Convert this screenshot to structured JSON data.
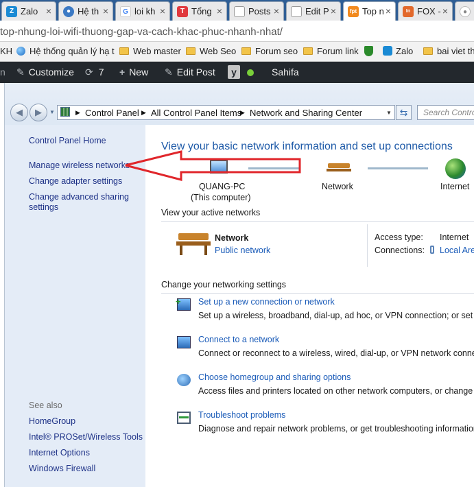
{
  "browser": {
    "tabs": [
      {
        "label": "Zalo",
        "icon": "zalo-icon",
        "color": "#1a8ad4"
      },
      {
        "label": "Hệ th",
        "icon": "globe-icon",
        "color": "#3b79c4"
      },
      {
        "label": "loi kh",
        "icon": "google-icon",
        "color": "#4285f4"
      },
      {
        "label": "Tổng",
        "icon": "t-logo-icon",
        "color": "#e0393e"
      },
      {
        "label": "Posts",
        "icon": "page-icon",
        "color": "#9a9a9a"
      },
      {
        "label": "Edit P",
        "icon": "page-icon",
        "color": "#9a9a9a"
      },
      {
        "label": "Top n",
        "icon": "fpt-icon",
        "color": "#f28a1e"
      },
      {
        "label": "FOX -",
        "icon": "inside-icon",
        "color": "#e2682b"
      },
      {
        "label": "",
        "icon": "globe-icon",
        "color": "#9a9a9a"
      }
    ],
    "tab_close": "×",
    "url": "top-nhung-loi-wifi-thuong-gap-va-cach-khac-phuc-nhanh-nhat/",
    "bookmarks": [
      {
        "label": "KH"
      },
      {
        "label": "Hệ thống quản lý hạ t",
        "icon": "globe-icon"
      },
      {
        "label": "Web master",
        "icon": "folder-icon"
      },
      {
        "label": "Web Seo",
        "icon": "folder-icon"
      },
      {
        "label": "Forum seo",
        "icon": "folder-icon"
      },
      {
        "label": "Forum link",
        "icon": "folder-icon"
      },
      {
        "label": "",
        "icon": "shield-icon"
      },
      {
        "label": "Zalo",
        "icon": "zalo-icon"
      },
      {
        "label": "bai viet thu",
        "icon": "folder-icon"
      }
    ]
  },
  "wp_bar": {
    "customize": "Customize",
    "updates": "7",
    "new": "New",
    "edit_post": "Edit Post",
    "sahifa": "Sahifa"
  },
  "explorer": {
    "breadcrumb": [
      "Control Panel",
      "All Control Panel Items",
      "Network and Sharing Center"
    ],
    "search_placeholder": "Search Control",
    "sidebar": {
      "home": "Control Panel Home",
      "links": [
        "Manage wireless networks",
        "Change adapter settings",
        "Change advanced sharing settings"
      ],
      "see_also_title": "See also",
      "see_also": [
        "HomeGroup",
        "Intel® PROSet/Wireless Tools",
        "Internet Options",
        "Windows Firewall"
      ]
    },
    "main": {
      "title": "View your basic network information and set up connections",
      "map": {
        "computer_name": "QUANG-PC",
        "computer_sub": "(This computer)",
        "network": "Network",
        "internet": "Internet"
      },
      "active_title": "View your active networks",
      "active": {
        "name": "Network",
        "type": "Public network",
        "access_label": "Access type:",
        "access_value": "Internet",
        "connections_label": "Connections:",
        "connections_value": "Local Are"
      },
      "settings_title": "Change your networking settings",
      "settings": [
        {
          "title": "Set up a new connection or network",
          "desc": "Set up a wireless, broadband, dial-up, ad hoc, or VPN connection; or set up a"
        },
        {
          "title": "Connect to a network",
          "desc": "Connect or reconnect to a wireless, wired, dial-up, or VPN network connectio"
        },
        {
          "title": "Choose homegroup and sharing options",
          "desc": "Access files and printers located on other network computers, or change sha"
        },
        {
          "title": "Troubleshoot problems",
          "desc": "Diagnose and repair network problems, or get troubleshooting information."
        }
      ]
    }
  },
  "colors": {
    "accent": "#1e5aa8",
    "annotation": "#e0262b",
    "wp_bar": "#23282d",
    "sidebar": "#e4ecf7"
  }
}
